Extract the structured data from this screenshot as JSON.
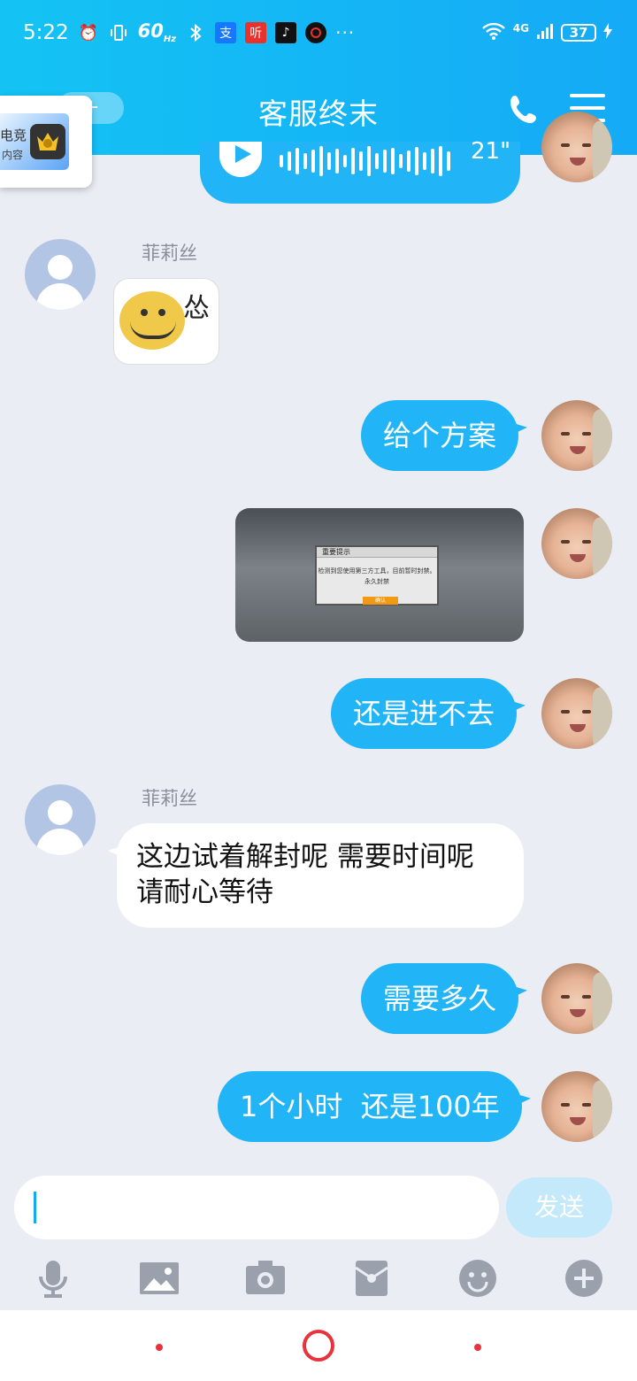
{
  "status_bar": {
    "time": "5:22",
    "refresh_rate": "60",
    "refresh_unit": "Hz",
    "network": "4G",
    "battery": "37",
    "icons": [
      "alarm-icon",
      "vibrate-icon",
      "bluetooth-icon",
      "alipay-icon",
      "ting-icon",
      "tiktok-icon",
      "record-icon",
      "more-icon",
      "wifi-icon",
      "signal-icon",
      "battery-icon",
      "charging-icon"
    ]
  },
  "header": {
    "title": "客服终末",
    "back_badge": "+",
    "icons": [
      "back-icon",
      "phone-icon",
      "menu-icon"
    ]
  },
  "floating_card": {
    "line1": "电竞",
    "line2": "内容"
  },
  "messages": {
    "voice": {
      "duration": "21\""
    },
    "m1": {
      "sender": "菲莉丝",
      "sticker_text": "怂"
    },
    "m2": {
      "text": "给个方案"
    },
    "m3": {
      "image": {
        "dialog_title": "重要提示",
        "dialog_text": "检测到您使用第三方工具，目前暂时封禁。",
        "dialog_text2": "永久封禁",
        "button": "确认"
      }
    },
    "m4": {
      "text": "还是进不去"
    },
    "m5": {
      "sender": "菲莉丝",
      "text": "这边试着解封呢 需要时间呢 请耐心等待"
    },
    "m6": {
      "text": "需要多久"
    },
    "m7": {
      "text": "1个小时  还是100年"
    }
  },
  "composer": {
    "placeholder": "",
    "send_label": "发送"
  },
  "toolbar_icons": [
    "microphone-icon",
    "image-icon",
    "camera-icon",
    "red-packet-icon",
    "emoji-icon",
    "plus-icon"
  ],
  "colors": {
    "accent": "#15aaf6",
    "outgoing_bubble": "#21b4f7",
    "background": "#eaedf4",
    "nav_red": "#e8323c"
  }
}
